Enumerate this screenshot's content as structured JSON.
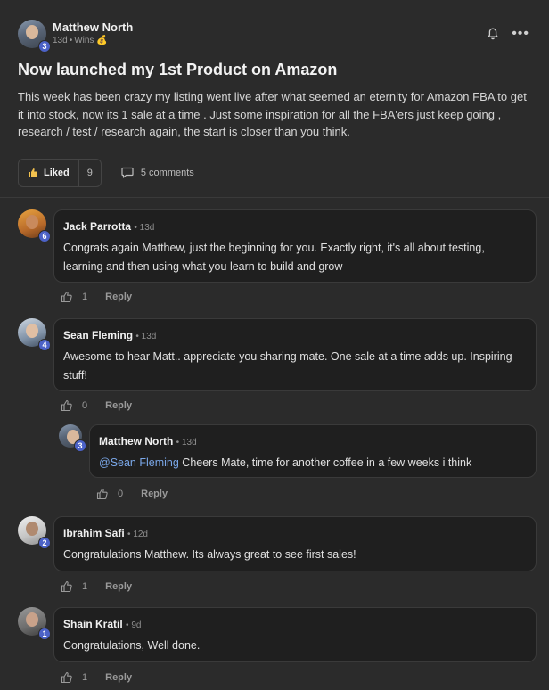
{
  "post": {
    "author": "Matthew North",
    "author_level": "3",
    "age": "13d",
    "category": "Wins",
    "category_emoji": "💰",
    "title": "Now launched my 1st Product on Amazon",
    "body": "This week has been crazy my listing went live after what seemed an eternity for Amazon FBA to get it into stock, now its 1 sale at a time . Just some inspiration for all the FBA'ers just keep going , research / test / research again, the start is closer than you think.",
    "like_label": "Liked",
    "like_count": "9",
    "comments_label": "5 comments",
    "more_label": "•••"
  },
  "comments": [
    {
      "name": "Jack Parrotta",
      "level": "6",
      "time": "13d",
      "text": "Congrats again Matthew, just the beginning for you. Exactly right, it's all about testing, learning and then using what you learn to build and grow",
      "likes": "1",
      "reply": "Reply"
    },
    {
      "name": "Sean Fleming",
      "level": "4",
      "time": "13d",
      "text": "Awesome to hear Matt.. appreciate you sharing mate. One sale at a time adds up. Inspiring stuff!",
      "likes": "0",
      "reply": "Reply"
    },
    {
      "name": "Matthew North",
      "level": "3",
      "time": "13d",
      "mention": "@Sean Fleming",
      "text": " Cheers Mate, time for another coffee in a few weeks i think",
      "likes": "0",
      "reply": "Reply"
    },
    {
      "name": "Ibrahim Safi",
      "level": "2",
      "time": "12d",
      "text": "Congratulations Matthew. Its always great to see first sales!",
      "likes": "1",
      "reply": "Reply"
    },
    {
      "name": "Shain Kratil",
      "level": "1",
      "time": "9d",
      "text": "Congratulations, Well done.",
      "likes": "1",
      "reply": "Reply"
    }
  ],
  "colors": {
    "background": "#2b2b2b",
    "bubble": "#1f1f1f",
    "level_badge": "#4c62c7",
    "mention": "#7aa7e8"
  }
}
